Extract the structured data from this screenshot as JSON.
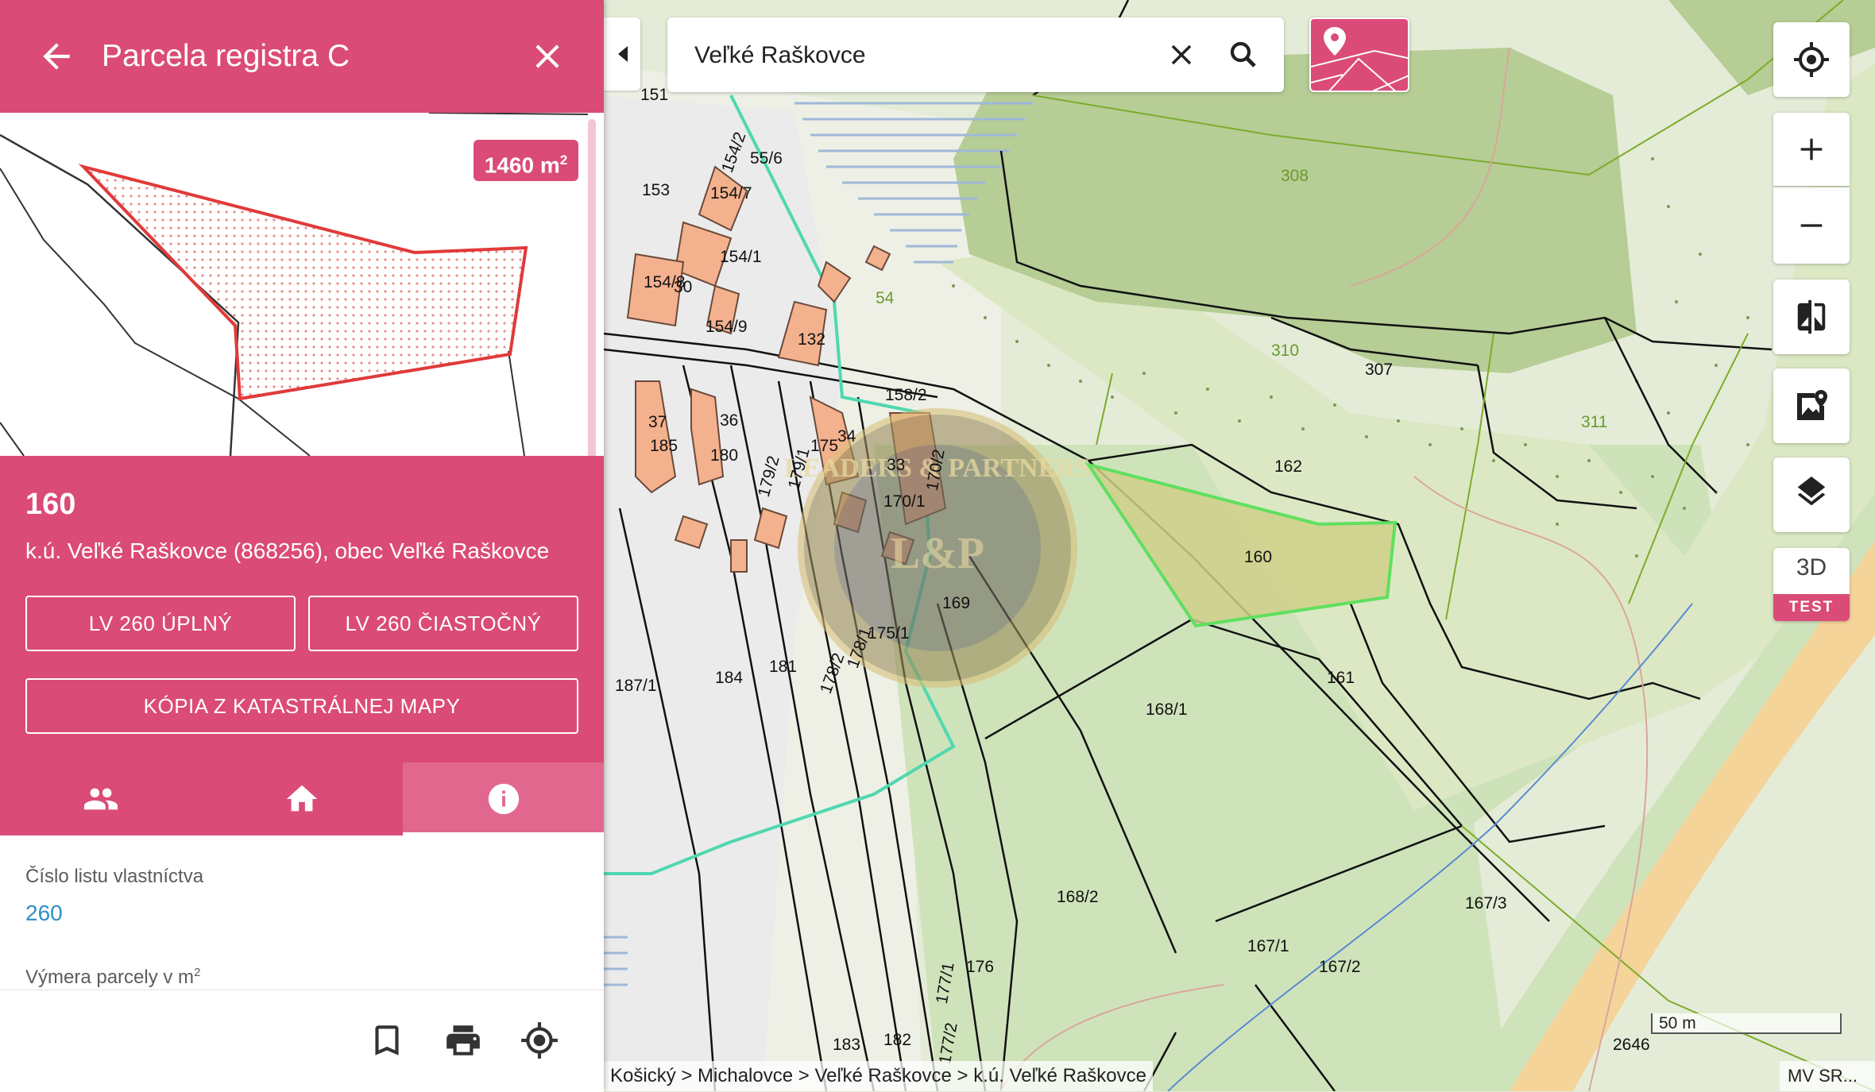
{
  "panel": {
    "title": "Parcela registra C",
    "area_badge": "1460 m",
    "area_badge_sup": "2",
    "parcel_number": "160",
    "parcel_location": "k.ú. Veľké Raškovce (868256), obec Veľké Raškovce",
    "buttons": {
      "lv_full": "LV 260 ÚPLNÝ",
      "lv_partial": "LV 260 ČIASTOČNÝ",
      "map_copy": "KÓPIA Z KATASTRÁLNEJ MAPY"
    },
    "tabs": [
      {
        "icon": "owners-icon",
        "active": false
      },
      {
        "icon": "building-icon",
        "active": false
      },
      {
        "icon": "info-icon",
        "active": true
      }
    ],
    "fields": [
      {
        "label": "Číslo listu vlastníctva",
        "value": "260"
      },
      {
        "label": "Výmera parcely v m",
        "label_sup": "2"
      }
    ],
    "bottom_icons": [
      "bookmark-icon",
      "print-icon",
      "locate-parcel-icon"
    ]
  },
  "search": {
    "value": "Veľké Raškovce"
  },
  "map_controls": {
    "buttons": [
      "gps-icon",
      "zoom-in-icon",
      "zoom-out-icon",
      "compare-icon",
      "geoportal-icon",
      "layers-icon"
    ],
    "three_d": "3D",
    "three_d_badge": "TEST"
  },
  "breadcrumb": "Košický > Michalovce > Veľké Raškovce > k.ú. Veľké Raškovce",
  "scale": "50 m",
  "attribution": "MV SR...",
  "parcel_labels": [
    "151",
    "153",
    "154/2",
    "55/6",
    "154/7",
    "154/1",
    "154/8",
    "30",
    "154/9",
    "132",
    "54",
    "308",
    "310",
    "307",
    "311",
    "162",
    "160",
    "161",
    "37",
    "36",
    "185",
    "180",
    "179/2",
    "179/1",
    "175",
    "34",
    "33",
    "170/2",
    "170/1",
    "169",
    "175/1",
    "158/2",
    "187/1",
    "184",
    "181",
    "178/2",
    "178/1",
    "168/1",
    "168/2",
    "176",
    "167/1",
    "167/2",
    "167/3",
    "177/1",
    "177/2",
    "183",
    "182",
    "2646"
  ],
  "watermark": "LEADERS & PARTNERS",
  "watermark_mono": "L&P"
}
